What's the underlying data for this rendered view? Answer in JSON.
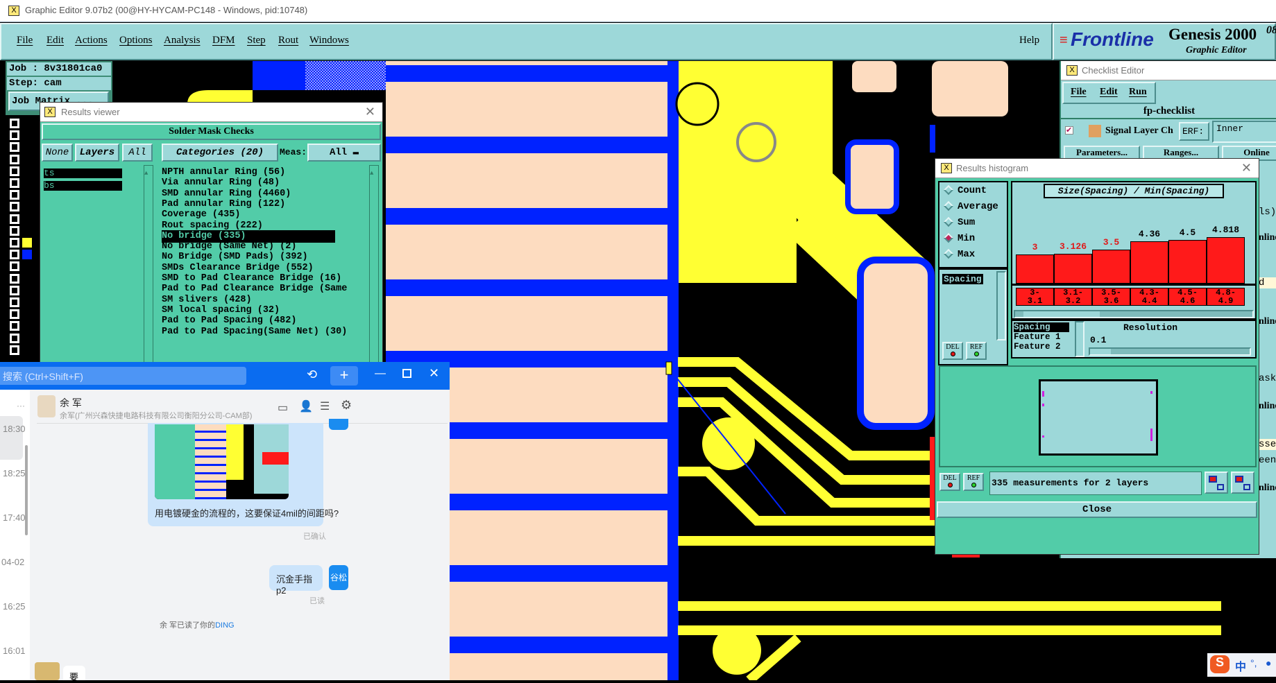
{
  "window": {
    "title": "Graphic Editor 9.07b2 (00@HY-HYCAM-PC148 - Windows, pid:10748)"
  },
  "menu": {
    "items": [
      "File",
      "Edit",
      "Actions",
      "Options",
      "Analysis",
      "DFM",
      "Step",
      "Rout",
      "Windows"
    ],
    "help": "Help"
  },
  "logo": {
    "brand": "Frontline",
    "product": "Genesis 2000",
    "version_fragment": "08",
    "subtitle": "Graphic Editor"
  },
  "left_panel": {
    "job": "Job : 8v31801ca0",
    "step": "Step: cam",
    "job_matrix": "Job Matrix ..."
  },
  "results_viewer": {
    "title": "Results viewer",
    "group": "Solder Mask Checks",
    "none_label": "None",
    "layers_label": "Layers",
    "all_label": "All",
    "categories_label": "Categories (20)",
    "meas_label": "Meas:",
    "meas_value": "All",
    "layers": [
      "ts",
      "bs"
    ],
    "categories": [
      "NPTH annular Ring (56)",
      "Via annular Ring (48)",
      "SMD annular Ring (4460)",
      "Pad annular Ring (122)",
      "Coverage (435)",
      "Rout spacing (222)",
      "No bridge (335)",
      "No bridge (Same Net) (2)",
      "No Bridge (SMD Pads) (392)",
      "SMDs Clearance Bridge (552)",
      "SMD to Pad Clearance Bridge (16)",
      "Pad to Pad Clearance Bridge (Same",
      "SM slivers (428)",
      "SM local spacing (32)",
      "Pad to Pad Spacing (482)",
      "Pad to Pad Spacing(Same Net) (30)"
    ],
    "selected_category": "No bridge (335)"
  },
  "checklist_editor": {
    "title": "Checklist Editor",
    "menu": [
      "File",
      "Edit",
      "Run"
    ],
    "name": "fp-checklist",
    "action_label": "Signal Layer Ch",
    "erf_label": "ERF:",
    "erf_value": "Inner",
    "buttons": [
      "Parameters...",
      "Ranges...",
      "Online"
    ],
    "fragments": [
      "ls)",
      "nline",
      "d",
      "nline",
      "ask",
      "nline",
      "sse",
      "een",
      "nline"
    ]
  },
  "histogram": {
    "title": "Results histogram",
    "modes": [
      {
        "label": "Count",
        "selected": false
      },
      {
        "label": "Average",
        "selected": false
      },
      {
        "label": "Sum",
        "selected": false
      },
      {
        "label": "Min",
        "selected": true
      },
      {
        "label": "Max",
        "selected": false
      }
    ],
    "left_list": [
      "Spacing"
    ],
    "field_list": [
      "Spacing",
      "Feature 1",
      "Feature 2"
    ],
    "resolution_label": "Resolution",
    "resolution_value": "0.1",
    "del_label": "DEL",
    "ref_label": "REF",
    "status": "335 measurements for 2 layers",
    "close_label": "Close"
  },
  "chart_data": {
    "type": "bar",
    "title": "Size(Spacing) / Min(Spacing)",
    "categories": [
      "3-\n3.1",
      "3.1-\n3.2",
      "3.5-\n3.6",
      "4.3-\n4.4",
      "4.5-\n4.6",
      "4.8-\n4.9"
    ],
    "values": [
      3,
      3.126,
      3.5,
      4.36,
      4.5,
      4.818
    ],
    "data_labels": [
      "3",
      "3.126",
      "3.5",
      "4.36",
      "4.5",
      "4.818"
    ],
    "label_colors": [
      "#e01818",
      "#e01818",
      "#e01818",
      "#000000",
      "#000000",
      "#000000"
    ],
    "bar_color": "#ff1a1a",
    "ylim": [
      0,
      5
    ]
  },
  "chat": {
    "search_placeholder": "搜索 (Ctrl+Shift+F)",
    "contact_name": "余 军",
    "contact_org": "余军(广州兴森快捷电路科技有限公司衡阳分公司-CAM部)",
    "times": [
      "18:30",
      "18:25",
      "17:40",
      "04-02",
      "16:25",
      "16:01"
    ],
    "messages": [
      {
        "text": "用电镀硬金的流程的，这要保证4mil的间距吗?",
        "status": "已确认"
      },
      {
        "text": "沉金手指p2",
        "status": "已读",
        "avatar": "谷松"
      }
    ],
    "notice_prefix": "余 军已读了你的",
    "notice_link": "DING",
    "incoming_fragment": "要",
    "more": "···"
  },
  "ime": {
    "label": "中",
    "punct": "°,"
  },
  "colors": {
    "teal": "#9dd8d9",
    "list_green": "#52cca8",
    "chat_blue": "#0a6cf0",
    "pcb_blue": "#0022ff",
    "pcb_yellow": "#ffff33",
    "pcb_beige": "#fddcc0"
  }
}
